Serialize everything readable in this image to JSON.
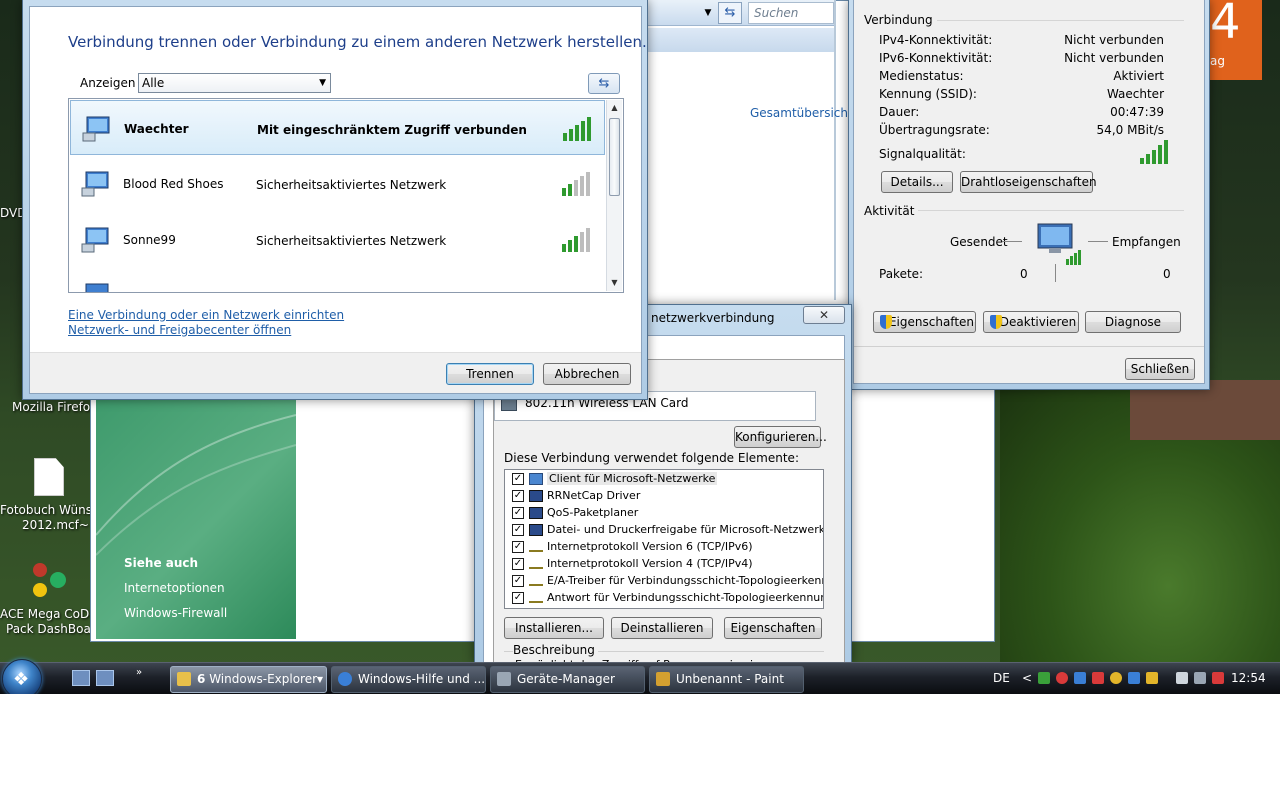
{
  "desktop": {
    "icons": [
      {
        "label": "DVD"
      },
      {
        "label": "Mozilla Firefox"
      },
      {
        "label_line1": "Fotobuch Wünsd",
        "label_line2": "2012.mcf~"
      },
      {
        "label_line1": "ACE Mega CoDe",
        "label_line2": "Pack DashBoard"
      }
    ],
    "tile": {
      "big": "4",
      "small": "ag"
    }
  },
  "explorer": {
    "search_placeholder": "Suchen",
    "link_overview": "Gesamtübersich"
  },
  "help_pane": {
    "title": "Siehe auch",
    "links": [
      "Internetoptionen",
      "Windows-Firewall"
    ]
  },
  "connect_dialog": {
    "title": "Verbindung trennen oder Verbindung zu einem anderen Netzwerk herstellen.",
    "show_label": "Anzeigen",
    "filter_value": "Alle",
    "networks": [
      {
        "name": "Waechter",
        "status": "Mit eingeschränktem Zugriff verbunden",
        "bars": 5
      },
      {
        "name": "Blood Red Shoes",
        "status": "Sicherheitsaktiviertes Netzwerk",
        "bars": 2
      },
      {
        "name": "Sonne99",
        "status": "Sicherheitsaktiviertes Netzwerk",
        "bars": 3
      }
    ],
    "link_setup": "Eine Verbindung oder ein Netzwerk einrichten",
    "link_center": "Netzwerk- und Freigabecenter öffnen",
    "disconnect_label": "Trennen",
    "cancel_label": "Abbrechen"
  },
  "status_dialog": {
    "group_connection": "Verbindung",
    "rows": [
      {
        "label": "IPv4-Konnektivität:",
        "value": "Nicht verbunden"
      },
      {
        "label": "IPv6-Konnektivität:",
        "value": "Nicht verbunden"
      },
      {
        "label": "Medienstatus:",
        "value": "Aktiviert"
      },
      {
        "label": "Kennung (SSID):",
        "value": "Waechter"
      },
      {
        "label": "Dauer:",
        "value": "00:47:39"
      },
      {
        "label": "Übertragungsrate:",
        "value": "54,0 MBit/s"
      }
    ],
    "signal_label": "Signalqualität:",
    "signal_bars": 5,
    "details_label": "Details...",
    "wireless_props_label": "Drahtloseigenschaften",
    "group_activity": "Aktivität",
    "sent_label": "Gesendet",
    "received_label": "Empfangen",
    "packets_label": "Pakete:",
    "packets_sent": "0",
    "packets_received": "0",
    "properties_label": "Eigenschaften",
    "disable_label": "Deaktivieren",
    "diagnose_label": "Diagnose",
    "close_label": "Schließen"
  },
  "props_dialog": {
    "title": "netzwerkverbindung",
    "adapter": "802.11n Wireless LAN Card",
    "configure_label": "Konfigurieren...",
    "elements_label": "Diese Verbindung verwendet folgende Elemente:",
    "items": [
      {
        "label": "Client für Microsoft-Netzwerke",
        "checked": true,
        "icon": "network-client-icon"
      },
      {
        "label": "RRNetCap Driver",
        "checked": true,
        "icon": "driver-icon"
      },
      {
        "label": "QoS-Paketplaner",
        "checked": true,
        "icon": "driver-icon"
      },
      {
        "label": "Datei- und Druckerfreigabe für Microsoft-Netzwerke",
        "checked": true,
        "icon": "driver-icon"
      },
      {
        "label": "Internetprotokoll Version 6 (TCP/IPv6)",
        "checked": true,
        "icon": "protocol-icon"
      },
      {
        "label": "Internetprotokoll Version 4 (TCP/IPv4)",
        "checked": true,
        "icon": "protocol-icon"
      },
      {
        "label": "E/A-Treiber für Verbindungsschicht-Topologieerkennun...",
        "checked": true,
        "icon": "protocol-icon"
      },
      {
        "label": "Antwort für Verbindungsschicht-Topologieerkennung",
        "checked": true,
        "icon": "protocol-icon"
      }
    ],
    "install_label": "Installieren...",
    "uninstall_label": "Deinstallieren",
    "properties_label": "Eigenschaften",
    "description_label": "Beschreibung",
    "description_text": "Ermöglicht den Zugriff auf Ressourcen in einem"
  },
  "taskbar": {
    "buttons": [
      {
        "count": "6",
        "label": "Windows-Explorer"
      },
      {
        "label": "Windows-Hilfe und ..."
      },
      {
        "label": "Geräte-Manager"
      },
      {
        "label": "Unbenannt - Paint"
      }
    ],
    "language": "DE",
    "clock": "12:54",
    "colors": {
      "accent": "#1e3f8a",
      "link": "#1f5ea8",
      "signal": "#2f9a2f"
    }
  }
}
